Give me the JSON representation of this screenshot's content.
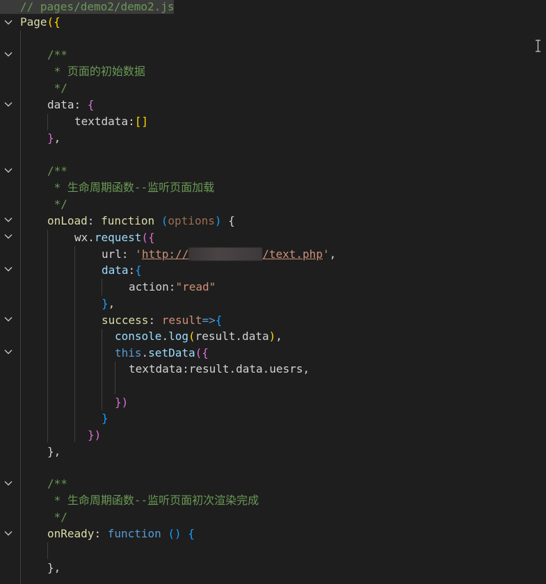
{
  "tab": {
    "title": "// pages/demo2/demo2.js"
  },
  "code": {
    "l1": {
      "page": "Page",
      "open": "({"
    },
    "l3": {
      "text": "/**"
    },
    "l4": {
      "text": " * 页面的初始数据"
    },
    "l5": {
      "text": " */"
    },
    "l6": {
      "key": "data",
      "colon": ": ",
      "brace": "{"
    },
    "l7": {
      "key": "textdata",
      "colon": ":",
      "arr": "[]"
    },
    "l8": {
      "close": "}",
      "comma": ","
    },
    "l10": {
      "text": "/**"
    },
    "l11": {
      "text": " * 生命周期函数--监听页面加载"
    },
    "l12": {
      "text": " */"
    },
    "l13": {
      "name": "onLoad",
      "colon": ": ",
      "kw": "function",
      "sp": " ",
      "po": "(",
      "param": "options",
      "pc": ")",
      "brace": " {"
    },
    "l14": {
      "obj": "wx",
      "dot": ".",
      "method": "request",
      "open": "({"
    },
    "l15": {
      "key": "url",
      "colon": ": ",
      "q": "'",
      "url_start": "http://",
      "url_end": "/text.php",
      "q2": "'",
      "comma": ","
    },
    "l16": {
      "key": "data",
      "colon": ":",
      "brace": "{"
    },
    "l17": {
      "key": "action",
      "colon": ":",
      "value": "\"read\""
    },
    "l18": {
      "close": "}",
      "comma": ","
    },
    "l19": {
      "key": "success",
      "colon": ": ",
      "param": "result",
      "arrow": "=>",
      "brace": "{"
    },
    "l20": {
      "obj": "console",
      "dot": ".",
      "method": "log",
      "po": "(",
      "arg": "result.data",
      "pc": ")",
      "semi": ","
    },
    "l21": {
      "kw": "this",
      "dot": ".",
      "method": "setData",
      "open": "({"
    },
    "l22": {
      "key": "textdata",
      "colon": ":",
      "value": "result.data.uesrs",
      "comma": ","
    },
    "l24": {
      "close": "})"
    },
    "l25": {
      "close": "}"
    },
    "l26": {
      "close": "})"
    },
    "l27": {
      "close": "}",
      "comma": ","
    },
    "l29": {
      "text": "/**"
    },
    "l30": {
      "text": " * 生命周期函数--监听页面初次渲染完成"
    },
    "l31": {
      "text": " */"
    },
    "l32": {
      "name": "onReady",
      "colon": ": ",
      "kw": "function",
      "parens": " ()",
      "brace": " {"
    },
    "l34": {
      "close": "}",
      "comma": ","
    }
  },
  "icons": {
    "fold": "chevron-down-icon",
    "cursor": "text-cursor-icon"
  },
  "colors": {
    "background": "#1e1e1e",
    "comment": "#6a9955",
    "function": "#dcdcaa",
    "keyword": "#569cd6",
    "property": "#9cdcfe",
    "string": "#ce9178"
  }
}
